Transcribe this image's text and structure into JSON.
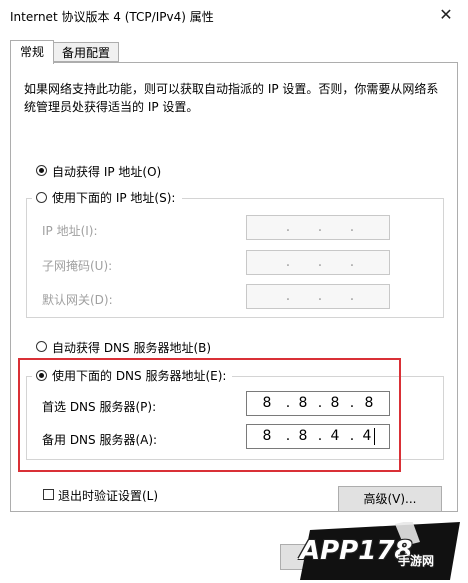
{
  "window": {
    "title": "Internet 协议版本 4 (TCP/IPv4) 属性",
    "close_icon": "✕"
  },
  "tabs": [
    {
      "label": "常规",
      "active": true
    },
    {
      "label": "备用配置",
      "active": false
    }
  ],
  "general": {
    "description": "如果网络支持此功能，则可以获取自动指派的 IP 设置。否则，你需要从网络系统管理员处获得适当的 IP 设置。",
    "auto_ip_label": "自动获得 IP 地址(O)",
    "manual_ip_label": "使用下面的 IP 地址(S):",
    "ip_address_label": "IP 地址(I):",
    "subnet_mask_label": "子网掩码(U):",
    "default_gateway_label": "默认网关(D):",
    "auto_dns_label": "自动获得 DNS 服务器地址(B)",
    "manual_dns_label": "使用下面的 DNS 服务器地址(E):",
    "preferred_dns_label": "首选 DNS 服务器(P):",
    "alternate_dns_label": "备用 DNS 服务器(A):",
    "preferred_dns": [
      "8",
      "8",
      "8",
      "8"
    ],
    "alternate_dns": [
      "8",
      "8",
      "4",
      "4"
    ],
    "validate_on_exit_label": "退出时验证设置(L)",
    "advanced_button": "高级(V)...",
    "ip_dot": "."
  },
  "selection": {
    "ip_mode": "auto",
    "dns_mode": "manual",
    "validate_on_exit": false
  },
  "watermark": {
    "text": "APP178",
    "sub": "手游网"
  },
  "colors": {
    "highlight_border": "#d93036"
  }
}
